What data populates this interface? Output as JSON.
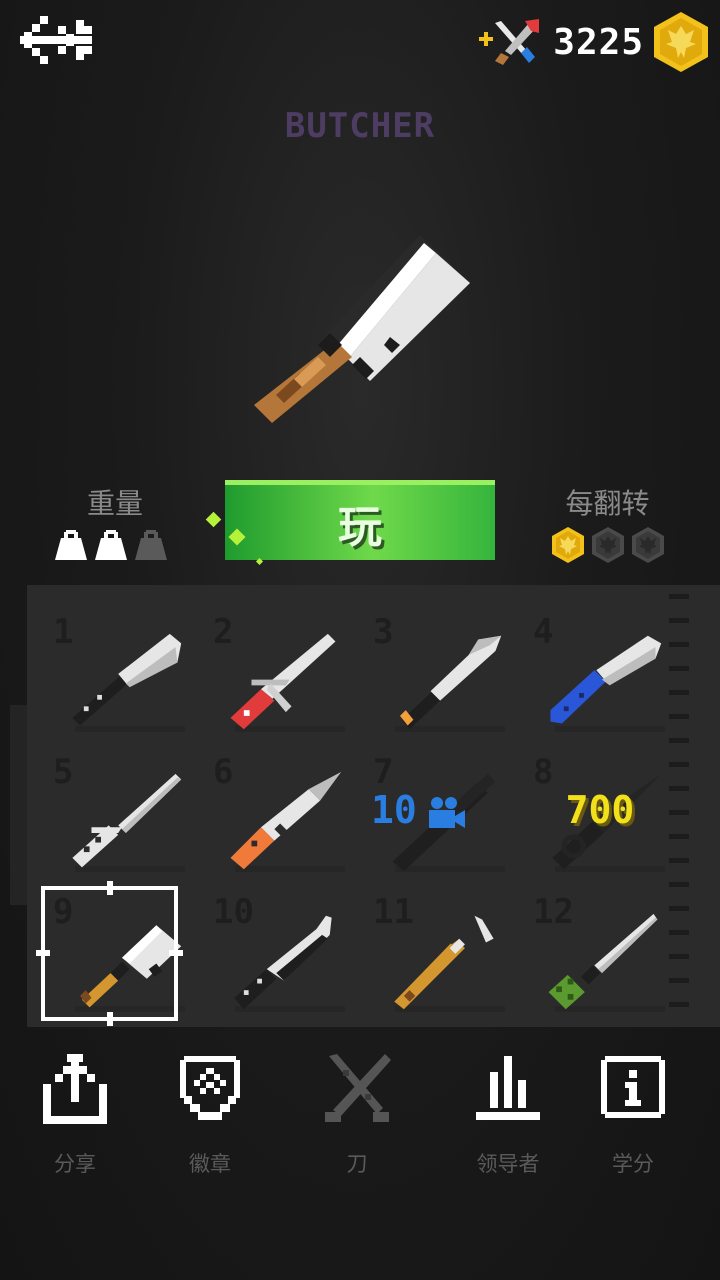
{
  "coins": "3225",
  "title": "BUTCHER",
  "play_label": "玩",
  "weight_label": "重量",
  "weight_level": 2,
  "weight_max": 3,
  "flip_label": "每翻转",
  "flip_level": 1,
  "flip_max": 3,
  "knives": [
    {
      "num": "1"
    },
    {
      "num": "2"
    },
    {
      "num": "3"
    },
    {
      "num": "4"
    },
    {
      "num": "5"
    },
    {
      "num": "6"
    },
    {
      "num": "7",
      "unlock_value": "10"
    },
    {
      "num": "8",
      "unlock_value": "700"
    },
    {
      "num": "9"
    },
    {
      "num": "10"
    },
    {
      "num": "11"
    },
    {
      "num": "12"
    }
  ],
  "selected_index": 9,
  "nav": [
    {
      "label": "分享",
      "icon": "share-icon"
    },
    {
      "label": "徽章",
      "icon": "badge-icon"
    },
    {
      "label": "刀",
      "icon": "crossed-knives-icon"
    },
    {
      "label": "领导者",
      "icon": "leaderboard-icon"
    },
    {
      "label": "学分",
      "icon": "info-icon"
    }
  ],
  "colors": {
    "title": "#4e3d63",
    "play_green": "#6fd94a",
    "coin_gold": "#f2c21b",
    "video_blue": "#2a7de1",
    "price_yellow": "#f2e01b",
    "nav_gray": "#5a5a5a"
  }
}
